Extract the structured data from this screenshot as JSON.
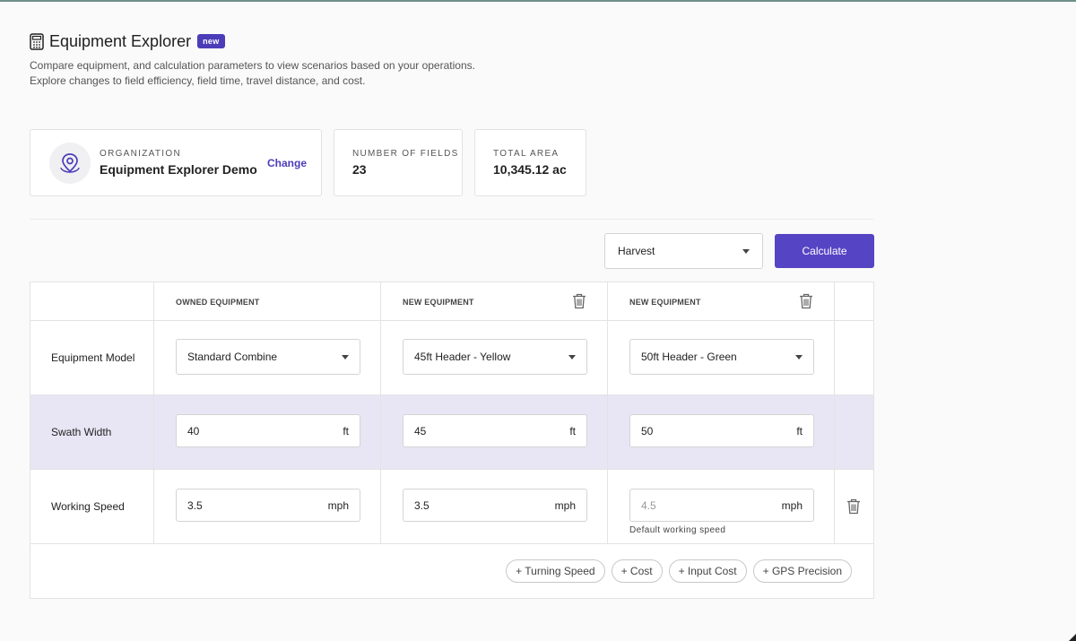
{
  "header": {
    "title": "Equipment Explorer",
    "badge": "new",
    "description_line1": "Compare equipment, and calculation parameters to view scenarios based on your operations.",
    "description_line2": "Explore changes to field efficiency, field time, travel distance, and cost."
  },
  "summary": {
    "organization_label": "ORGANIZATION",
    "organization_name": "Equipment Explorer Demo",
    "change_label": "Change",
    "fields_label": "NUMBER OF FIELDS",
    "fields_value": "23",
    "area_label": "TOTAL AREA",
    "area_value": "10,345.12 ac"
  },
  "controls": {
    "operation_selected": "Harvest",
    "calculate_label": "Calculate"
  },
  "table": {
    "columns": [
      "OWNED EQUIPMENT",
      "NEW EQUIPMENT",
      "NEW EQUIPMENT"
    ],
    "rows": {
      "model": {
        "label": "Equipment Model",
        "values": [
          "Standard Combine",
          "45ft Header - Yellow",
          "50ft Header - Green"
        ]
      },
      "swath": {
        "label": "Swath Width",
        "unit": "ft",
        "values": [
          "40",
          "45",
          "50"
        ]
      },
      "speed": {
        "label": "Working Speed",
        "unit": "mph",
        "values": [
          "3.5",
          "3.5",
          "4.5"
        ],
        "helper": "Default working speed"
      }
    },
    "add_chips": [
      "+ Turning Speed",
      "+ Cost",
      "+ Input Cost",
      "+ GPS Precision"
    ]
  },
  "colors": {
    "accent": "#5545c4",
    "row_highlight": "#e8e6f4"
  }
}
